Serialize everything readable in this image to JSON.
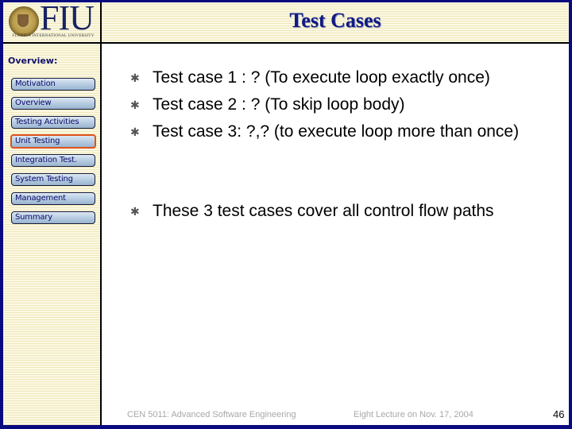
{
  "header": {
    "logo_text": "FIU",
    "logo_subtext": "FLORIDA INTERNATIONAL UNIVERSITY",
    "title": "Test Cases"
  },
  "sidebar": {
    "heading": "Overview:",
    "items": [
      {
        "label": "Motivation",
        "active": false
      },
      {
        "label": "Overview",
        "active": false
      },
      {
        "label": "Testing Activities",
        "active": false
      },
      {
        "label": "Unit Testing",
        "active": true
      },
      {
        "label": "Integration Test.",
        "active": false
      },
      {
        "label": "System Testing",
        "active": false
      },
      {
        "label": "Management",
        "active": false
      },
      {
        "label": "Summary",
        "active": false
      }
    ]
  },
  "content": {
    "bullet_icon": "asterisk-bullet",
    "bullets": [
      {
        "text": "Test case 1 : ? (To execute loop exactly once)"
      },
      {
        "text": "Test case 2 : ? (To skip loop body)"
      },
      {
        "text": "Test case 3: ?,? (to execute loop more than once)"
      },
      {
        "text": "These 3 test cases cover all control flow paths"
      }
    ]
  },
  "footer": {
    "course": "CEN 5011: Advanced Software Engineering",
    "lecture": "Eight Lecture on Nov. 17, 2004",
    "page_number": "46"
  },
  "colors": {
    "frame": "#0a0a80",
    "title": "#111a80",
    "active_nav_border": "#e0521c",
    "stripe_background": "#fbf8e2"
  }
}
